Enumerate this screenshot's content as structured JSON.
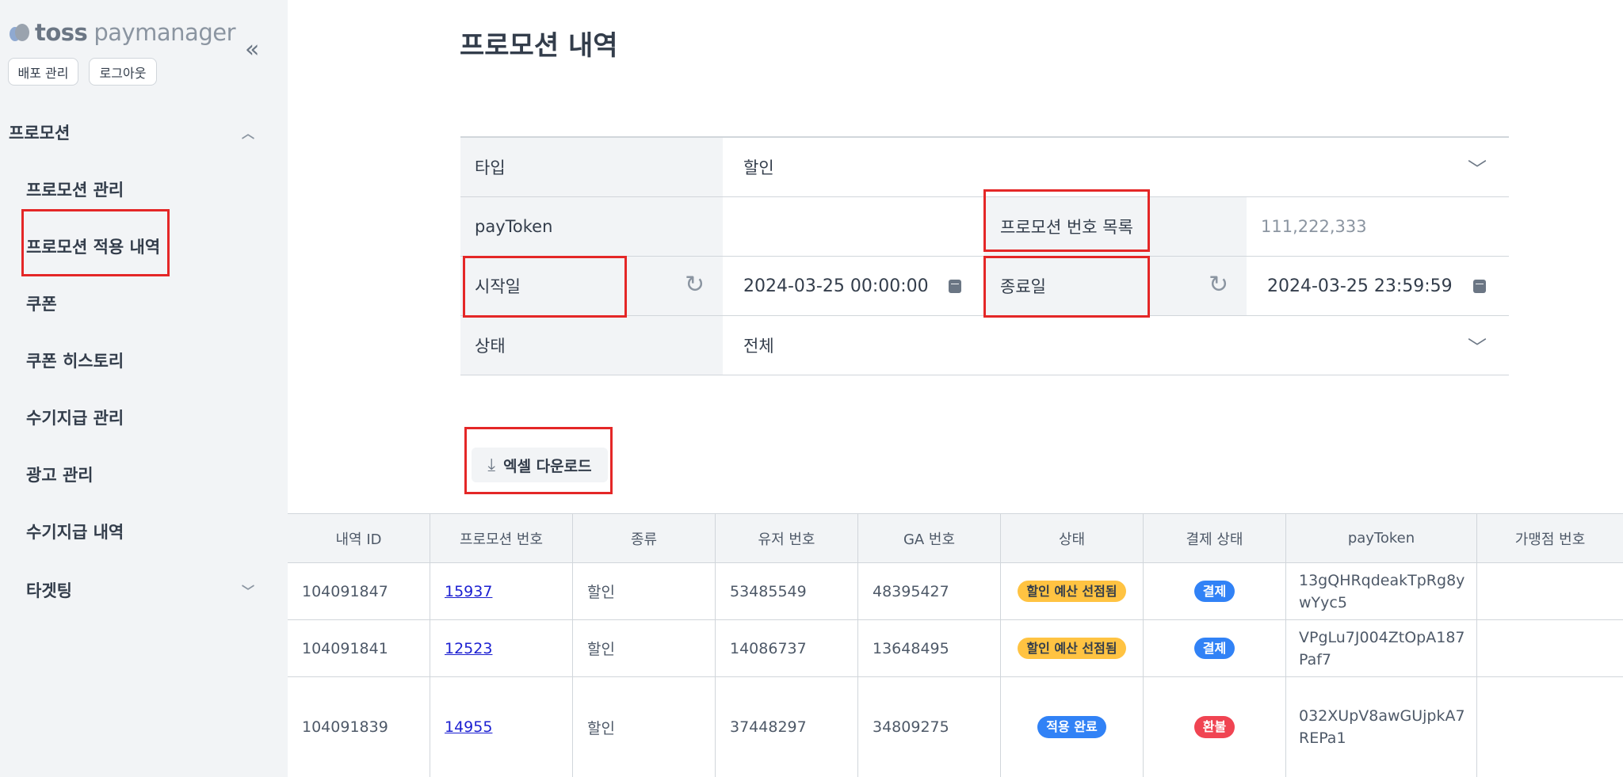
{
  "sidebar": {
    "logo_bold": "toss",
    "logo_light": "paymanager",
    "deploy_button": "배포 관리",
    "logout_button": "로그아웃",
    "section_promotion": "프로모션",
    "items": [
      "프로모션 관리",
      "프로모션 적용 내역",
      "쿠폰",
      "쿠폰 히스토리",
      "수기지급 관리",
      "광고 관리",
      "수기지급 내역"
    ],
    "section_targeting": "타겟팅"
  },
  "page": {
    "title": "프로모션 내역"
  },
  "filters": {
    "type_label": "타입",
    "type_value": "할인",
    "paytoken_label": "payToken",
    "promo_numbers_label": "프로모션 번호 목록",
    "promo_numbers_placeholder": "111,222,333",
    "start_label": "시작일",
    "start_value": "2024-03-25 00:00:00",
    "end_label": "종료일",
    "end_value": "2024-03-25 23:59:59",
    "status_label": "상태",
    "status_value": "전체"
  },
  "excel_button": "엑셀 다운로드",
  "table": {
    "headers": [
      "내역 ID",
      "프로모션 번호",
      "종류",
      "유저 번호",
      "GA 번호",
      "상태",
      "결제 상태",
      "payToken",
      "가맹점 번호"
    ],
    "rows": [
      {
        "id": "104091847",
        "promo": "15937",
        "kind": "할인",
        "user": "53485549",
        "ga": "48395427",
        "status": "할인 예산 선점됨",
        "pay_status": "결제",
        "token": "13gQHRqdeakTpRg8ywYyc5",
        "merchant": ""
      },
      {
        "id": "104091841",
        "promo": "12523",
        "kind": "할인",
        "user": "14086737",
        "ga": "13648495",
        "status": "할인 예산 선점됨",
        "pay_status": "결제",
        "token": "VPgLu7J004ZtOpA187Paf7",
        "merchant": ""
      },
      {
        "id": "104091839",
        "promo": "14955",
        "kind": "할인",
        "user": "37448297",
        "ga": "34809275",
        "status": "적용 완료",
        "pay_status": "환불",
        "token": "032XUpV8awGUjpkA7REPa1",
        "merchant": ""
      }
    ]
  },
  "colors": {
    "badge_reserved": "#ffc342",
    "badge_applied": "#3182f6",
    "badge_paid": "#3182f6",
    "badge_refund": "#f04452",
    "highlight": "#e42727"
  }
}
